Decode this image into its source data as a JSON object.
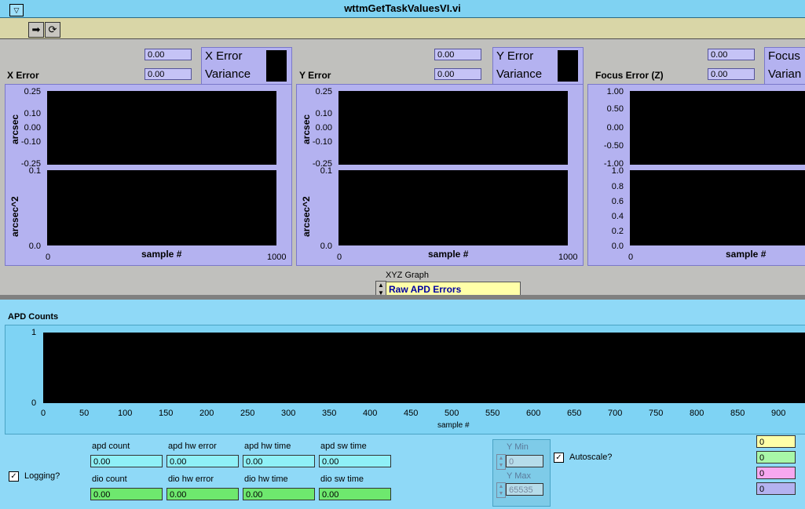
{
  "window": {
    "title": "wttmGetTaskValuesVI.vi"
  },
  "panels": [
    {
      "header": "X Error",
      "val1": "0.00",
      "val2": "0.00",
      "legend1": "X Error",
      "legend2": "Variance",
      "top_ticks": [
        "0.25",
        "0.10",
        "0.00",
        "-0.10",
        "-0.25"
      ],
      "top_axis": "arcsec",
      "bottom_ticks": [
        "0.1",
        "0.0"
      ],
      "bottom_axis": "arcsec^2",
      "x_ticks": [
        "0",
        "1000"
      ],
      "x_label": "sample #"
    },
    {
      "header": "Y Error",
      "val1": "0.00",
      "val2": "0.00",
      "legend1": "Y Error",
      "legend2": "Variance",
      "top_ticks": [
        "0.25",
        "0.10",
        "0.00",
        "-0.10",
        "-0.25"
      ],
      "top_axis": "arcsec",
      "bottom_ticks": [
        "0.1",
        "0.0"
      ],
      "bottom_axis": "arcsec^2",
      "x_ticks": [
        "0",
        "1000"
      ],
      "x_label": "sample #"
    },
    {
      "header": "Focus Error (Z)",
      "val1": "0.00",
      "val2": "0.00",
      "legend1": "Focus",
      "legend2": "Varian",
      "top_ticks": [
        "1.00",
        "0.50",
        "0.00",
        "-0.50",
        "-1.00"
      ],
      "bottom_ticks": [
        "1.0",
        "0.8",
        "0.6",
        "0.4",
        "0.2",
        "0.0"
      ],
      "x_ticks": [
        "0"
      ],
      "x_label": "sample #"
    }
  ],
  "xyz": {
    "label": "XYZ Graph",
    "value": "Raw APD Errors"
  },
  "apd": {
    "title": "APD Counts",
    "y_ticks": [
      "1",
      "0"
    ],
    "x_label": "sample #",
    "x_ticks": [
      "0",
      "50",
      "100",
      "150",
      "200",
      "250",
      "300",
      "350",
      "400",
      "450",
      "500",
      "550",
      "600",
      "650",
      "700",
      "750",
      "800",
      "850",
      "900"
    ]
  },
  "fields": {
    "apd_count": {
      "label": "apd count",
      "value": "0.00"
    },
    "apd_hw_error": {
      "label": "apd hw error",
      "value": "0.00"
    },
    "apd_hw_time": {
      "label": "apd hw time",
      "value": "0.00"
    },
    "apd_sw_time": {
      "label": "apd sw time",
      "value": "0.00"
    },
    "dio_count": {
      "label": "dio count",
      "value": "0.00"
    },
    "dio_hw_error": {
      "label": "dio hw error",
      "value": "0.00"
    },
    "dio_hw_time": {
      "label": "dio hw time",
      "value": "0.00"
    },
    "dio_sw_time": {
      "label": "dio sw time",
      "value": "0.00"
    }
  },
  "logging": {
    "label": "Logging?",
    "checked": true
  },
  "autoscale": {
    "label": "Autoscale?",
    "checked": true
  },
  "ymin": {
    "label": "Y Min",
    "value": "0"
  },
  "ymax": {
    "label": "Y Max",
    "value": "65535"
  },
  "counters": [
    {
      "value": "0",
      "color": "#ffffa8"
    },
    {
      "value": "0",
      "color": "#a8f7a8"
    },
    {
      "value": "0",
      "color": "#f7a8f0"
    },
    {
      "value": "0",
      "color": "#b4b2f0"
    }
  ],
  "colors": {
    "cyan_field": "#8ff0f7",
    "green_field": "#6ee86e",
    "yellow_field": "#ffffa8"
  }
}
